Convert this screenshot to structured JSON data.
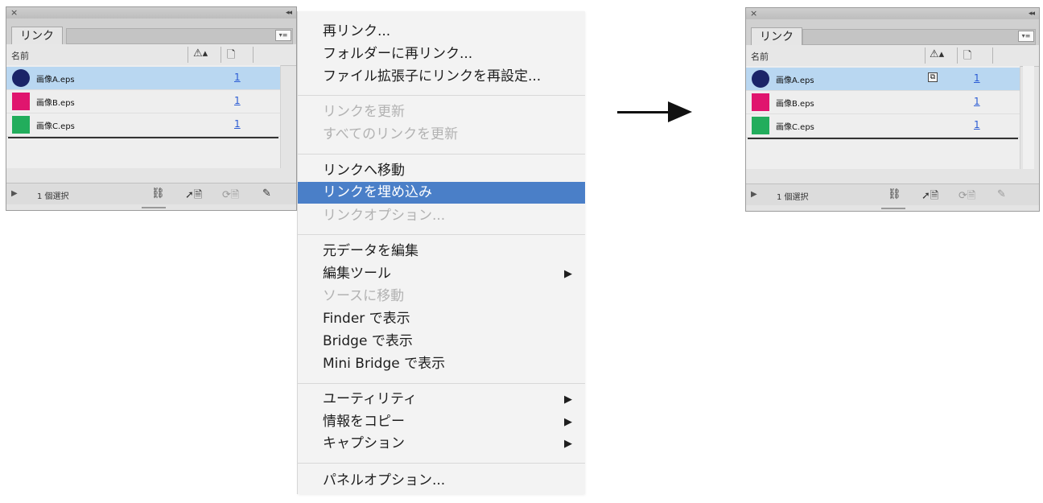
{
  "panel_before": {
    "close_glyph": "×",
    "collapse_glyph": "◂◂",
    "tab_label": "リンク",
    "menu_button_glyph": "▾≡",
    "column_name": "名前",
    "column_status_glyph": "⚠▴",
    "column_page_glyph": "🗋",
    "rows": [
      {
        "name": "画像A.eps",
        "page": "1",
        "selected": true
      },
      {
        "name": "画像B.eps",
        "page": "1",
        "selected": false
      },
      {
        "name": "画像C.eps",
        "page": "1",
        "selected": false
      }
    ],
    "footer": {
      "expand_glyph": "▶",
      "selection_count": "1 個選択",
      "relink_glyph": "⛓",
      "goto_glyph": "➚🗎",
      "update_glyph": "⟳🗎",
      "edit_glyph": "✎"
    }
  },
  "menu": {
    "items": [
      {
        "label": "再リンク...",
        "disabled": false
      },
      {
        "label": "フォルダーに再リンク...",
        "disabled": false
      },
      {
        "label": "ファイル拡張子にリンクを再設定...",
        "disabled": false
      },
      {
        "label": "リンクを更新",
        "disabled": true
      },
      {
        "label": "すべてのリンクを更新",
        "disabled": true
      },
      {
        "label": "リンクへ移動",
        "disabled": false
      },
      {
        "label": "リンクを埋め込み",
        "disabled": false,
        "highlighted": true
      },
      {
        "label": "リンクオプション...",
        "disabled": true
      },
      {
        "label": "元データを編集",
        "disabled": false
      },
      {
        "label": "編集ツール",
        "disabled": false,
        "submenu": true
      },
      {
        "label": "ソースに移動",
        "disabled": true
      },
      {
        "label": "Finder で表示",
        "disabled": false
      },
      {
        "label": "Bridge で表示",
        "disabled": false
      },
      {
        "label": "Mini Bridge で表示",
        "disabled": false
      },
      {
        "label": "ユーティリティ",
        "disabled": false,
        "submenu": true
      },
      {
        "label": "情報をコピー",
        "disabled": false,
        "submenu": true
      },
      {
        "label": "キャプション",
        "disabled": false,
        "submenu": true
      },
      {
        "label": "パネルオプション...",
        "disabled": false
      }
    ],
    "submenu_glyph": "▶",
    "highlight_color": "#4a7fc8"
  },
  "panel_after": {
    "close_glyph": "×",
    "collapse_glyph": "◂◂",
    "tab_label": "リンク",
    "menu_button_glyph": "▾≡",
    "column_name": "名前",
    "column_status_glyph": "⚠▴",
    "column_page_glyph": "🗋",
    "embedded_glyph": "⧉",
    "rows": [
      {
        "name": "画像A.eps",
        "page": "1",
        "selected": true,
        "embedded": true
      },
      {
        "name": "画像B.eps",
        "page": "1",
        "selected": false
      },
      {
        "name": "画像C.eps",
        "page": "1",
        "selected": false
      }
    ],
    "footer": {
      "expand_glyph": "▶",
      "selection_count": "1 個選択",
      "relink_glyph": "⛓",
      "goto_glyph": "➚🗎",
      "update_glyph": "⟳🗎",
      "edit_glyph": "✎"
    }
  },
  "colors": {
    "thumb_a": "#1b2468",
    "thumb_b": "#e0156e",
    "thumb_c": "#22ad5c",
    "selection": "#b9d7f1",
    "page_link": "#2a5bd4"
  }
}
